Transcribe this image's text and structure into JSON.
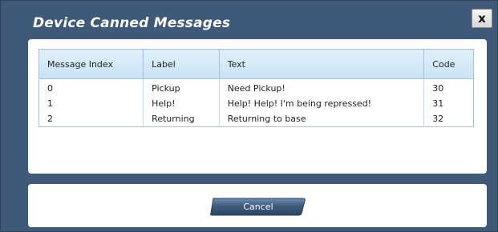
{
  "dialog": {
    "title": "Device Canned Messages",
    "close_label": "x"
  },
  "table": {
    "headers": {
      "index": "Message Index",
      "label": "Label",
      "text": "Text",
      "code": "Code"
    },
    "rows": [
      {
        "index": "0",
        "label": "Pickup",
        "text": "Need Pickup!",
        "code": "30"
      },
      {
        "index": "1",
        "label": "Help!",
        "text": "Help! Help! I'm being repressed!",
        "code": "31"
      },
      {
        "index": "2",
        "label": "Returning",
        "text": "Returning to base",
        "code": "32"
      }
    ]
  },
  "footer": {
    "cancel_label": "Cancel"
  },
  "colors": {
    "frame": "#3f5a78",
    "header_bg": "#cfe6f7",
    "button": "#3d5878"
  }
}
